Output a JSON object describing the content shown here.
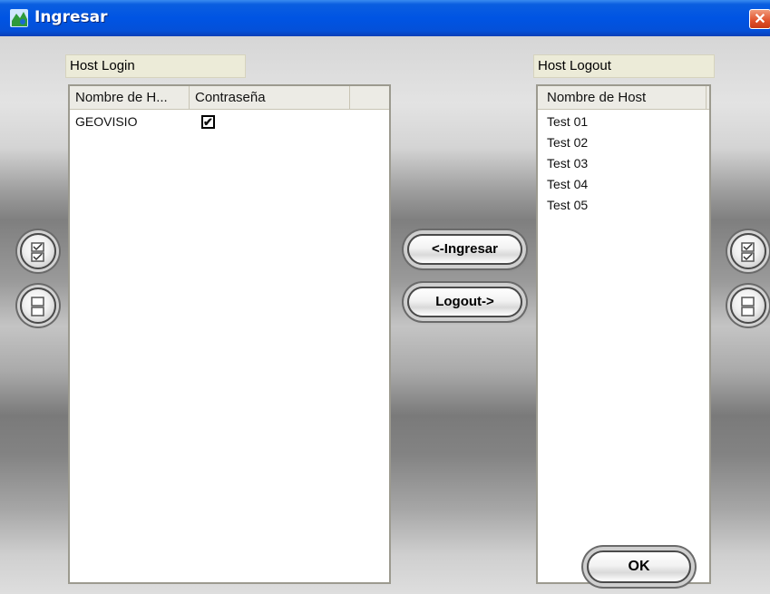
{
  "window": {
    "title": "Ingresar",
    "close_glyph": "✕"
  },
  "icons": {
    "app": "app-globe-icon",
    "select_all": "select-all-checkbox-icon",
    "clear_all": "clear-all-checkbox-icon"
  },
  "host_login": {
    "label": "Host Login",
    "columns": [
      "Nombre de H...",
      "Contraseña"
    ],
    "rows": [
      {
        "name": "GEOVISIO",
        "password_checked": true,
        "check_glyph": "✔"
      }
    ]
  },
  "host_logout": {
    "label": "Host Logout",
    "column": "Nombre de Host",
    "rows": [
      "Test 01",
      "Test 02",
      "Test 03",
      "Test 04",
      "Test 05"
    ]
  },
  "buttons": {
    "ingresar": "<-Ingresar",
    "logout": "Logout->",
    "ok": "OK"
  },
  "colors": {
    "titlebar": "#0054e3",
    "label_bg": "#ecebd8",
    "list_bg": "#ffffff"
  }
}
